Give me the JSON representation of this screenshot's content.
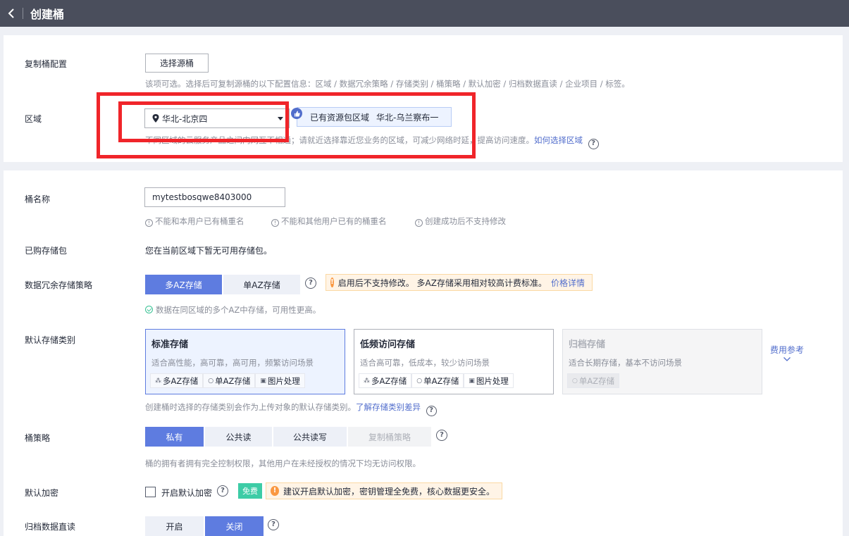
{
  "header": {
    "title": "创建桶"
  },
  "replicate": {
    "label": "复制桶配置",
    "button": "选择源桶",
    "hint": "该项可选。选择后可复制源桶的以下配置信息：区域 / 数据冗余策略 / 存储类别 / 桶策略 / 默认加密 / 归档数据直读 / 企业项目 / 标签。"
  },
  "region": {
    "label": "区域",
    "selected": "华北-北京四",
    "respkg_text": "已有资源包区域",
    "respkg_region": "华北-乌兰察布一",
    "hint": "不同区域的云服务产品之间内网互不相通；请就近选择靠近您业务的区域，可减少网络时延，提高访问速度。",
    "hint_link": "如何选择区域"
  },
  "bucket_name": {
    "label": "桶名称",
    "value": "mytestbosqwe8403000",
    "rules": [
      "不能和本用户已有桶重名",
      "不能和其他用户已有的桶重名",
      "创建成功后不支持修改"
    ]
  },
  "package": {
    "label": "已购存储包",
    "text": "您在当前区域下暂无可用存储包。"
  },
  "redundancy": {
    "label": "数据冗余存储策略",
    "options": [
      "多AZ存储",
      "单AZ存储"
    ],
    "warning": "启用后不支持修改。 多AZ存储采用相对较高计费标准。",
    "warning_link": "价格详情",
    "hint": "数据在同区域的多个AZ中存储，可用性更高。"
  },
  "storage_class": {
    "label": "默认存储类别",
    "cards": [
      {
        "title": "标准存储",
        "desc": "适合高性能，高可靠，高可用，频繁访问场景",
        "tags": [
          "多AZ存储",
          "单AZ存储",
          "图片处理"
        ]
      },
      {
        "title": "低频访问存储",
        "desc": "适合高可靠，低成本，较少访问场景",
        "tags": [
          "多AZ存储",
          "单AZ存储",
          "图片处理"
        ]
      },
      {
        "title": "归档存储",
        "desc": "适合长期存储，基本不访问场景",
        "tags": [
          "单AZ存储"
        ]
      }
    ],
    "cost_ref": "费用参考",
    "hint": "创建桶时选择的存储类别会作为上传对象的默认存储类别。",
    "hint_link": "了解存储类别差异"
  },
  "policy": {
    "label": "桶策略",
    "options": [
      "私有",
      "公共读",
      "公共读写",
      "复制桶策略"
    ],
    "hint": "桶的拥有者拥有完全控制权限，其他用户在未经授权的情况下均无访问权限。"
  },
  "encryption": {
    "label": "默认加密",
    "checkbox_label": "开启默认加密",
    "badge": "免费",
    "tip": "建议开启默认加密，密钥管理全免费，核心数据更安全。"
  },
  "archive_read": {
    "label": "归档数据直读",
    "options": [
      "开启",
      "关闭"
    ]
  },
  "colors": {
    "primary": "#5e7ce0",
    "link": "#526ecc",
    "header_bg": "#4a4e5c",
    "highlight": "#f0252a",
    "warning": "#fa9841",
    "free_badge": "#3dcca6"
  },
  "icons": [
    "back-arrow-icon",
    "location-pin-icon",
    "caret-down-icon",
    "thumbs-up-icon",
    "info-icon",
    "help-icon",
    "warning-icon",
    "check-circle-icon",
    "chevron-down-icon"
  ]
}
